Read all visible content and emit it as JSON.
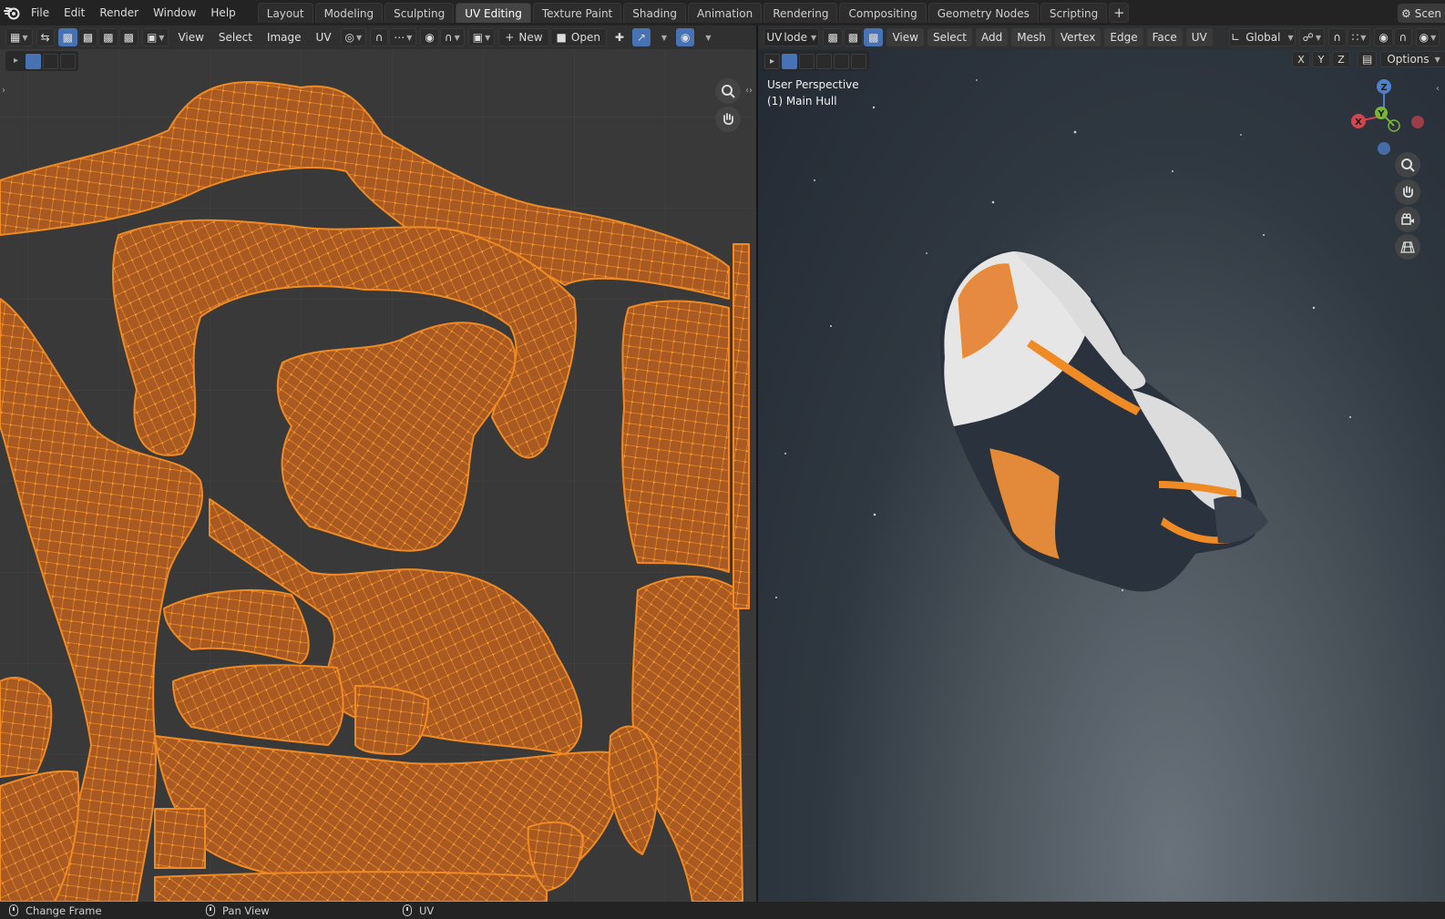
{
  "menu": [
    "File",
    "Edit",
    "Render",
    "Window",
    "Help"
  ],
  "workspace_tabs": [
    {
      "label": "Layout",
      "active": false
    },
    {
      "label": "Modeling",
      "active": false
    },
    {
      "label": "Sculpting",
      "active": false
    },
    {
      "label": "UV Editing",
      "active": true
    },
    {
      "label": "Texture Paint",
      "active": false
    },
    {
      "label": "Shading",
      "active": false
    },
    {
      "label": "Animation",
      "active": false
    },
    {
      "label": "Rendering",
      "active": false
    },
    {
      "label": "Compositing",
      "active": false
    },
    {
      "label": "Geometry Nodes",
      "active": false
    },
    {
      "label": "Scripting",
      "active": false
    }
  ],
  "add_workspace_label": "+",
  "scene_label": "Scen",
  "uv_editor": {
    "menus": [
      "View",
      "Select",
      "Image",
      "UV"
    ],
    "new_label": "New",
    "open_label": "Open",
    "new_icon": "plus-icon",
    "open_icon": "folder-icon"
  },
  "viewport": {
    "mode_label": "UV",
    "mode_dropdown_label": "lode",
    "menus": [
      "View",
      "Select",
      "Add",
      "Mesh",
      "Vertex",
      "Edge",
      "Face",
      "UV"
    ],
    "orientation": "Global",
    "axis_x": "X",
    "axis_y": "Y",
    "axis_z": "Z",
    "options_label": "Options",
    "view_name": "User Perspective",
    "object_name": "(1) Main Hull",
    "gizmo": {
      "z": "Z",
      "y": "Y",
      "x": "X"
    }
  },
  "status_bar": [
    {
      "label": "Change Frame",
      "icon": "mouse-icon"
    },
    {
      "label": "Pan View",
      "icon": "mouse-icon"
    },
    {
      "label": "UV",
      "icon": "mouse-icon"
    }
  ],
  "colors": {
    "uv_mesh": "#f08a24",
    "uv_face": "#a85a22",
    "uv_bg": "#393939",
    "active_tab": "#454545",
    "accent_blue": "#4772b3",
    "hull_white": "#e9e9e9",
    "hull_dark": "#2a323d"
  }
}
